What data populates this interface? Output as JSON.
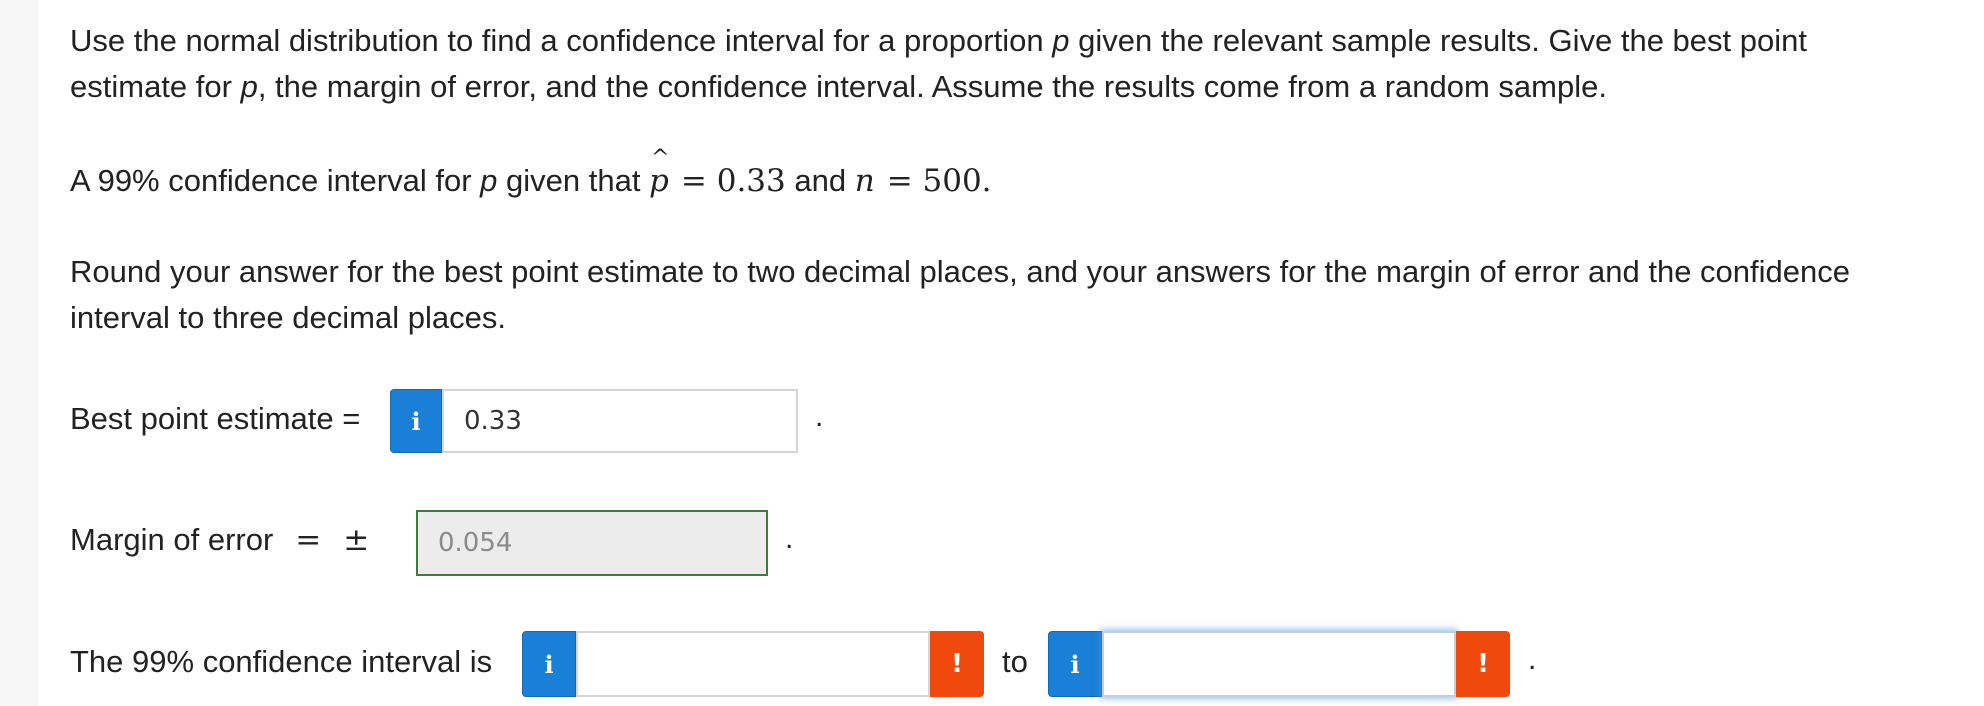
{
  "question": {
    "intro_line1_a": "Use the normal distribution to find a confidence interval for a proportion ",
    "intro_line1_var": "p",
    "intro_line1_b": " given the relevant sample results. Give the best point",
    "intro_line2_a": "estimate for ",
    "intro_line2_var": "p",
    "intro_line2_b": ", the margin of error, and the confidence interval. Assume the results come from a random sample.",
    "problem_a": "A 99% confidence interval for ",
    "problem_var": "p",
    "problem_b": " given that ",
    "phat_symbol": "p",
    "hat_symbol": "^",
    "phat_value": "= 0.33",
    "problem_and": " and ",
    "n_symbol": "n",
    "n_value": "= 500.",
    "round_line1": "Round your answer for the best point estimate to two decimal places, and your answers for the margin of error and the confidence",
    "round_line2": "interval to three decimal places."
  },
  "best_point": {
    "label": "Best point estimate =",
    "info": "i",
    "value": "0.33",
    "period": "."
  },
  "margin": {
    "label": "Margin of error",
    "equals": "=",
    "plus_minus": "±",
    "value": "0.054",
    "period": "."
  },
  "interval": {
    "label": "The 99% confidence interval is",
    "info_lower": "i",
    "lower_value": "",
    "warn_lower": "!",
    "to_label": "to",
    "info_upper": "i",
    "upper_value": "",
    "warn_upper": "!",
    "period": "."
  },
  "colors": {
    "info_blue": "#1a7fd6",
    "warn_orange": "#f0490e",
    "correct_green": "#3d7d3a"
  }
}
